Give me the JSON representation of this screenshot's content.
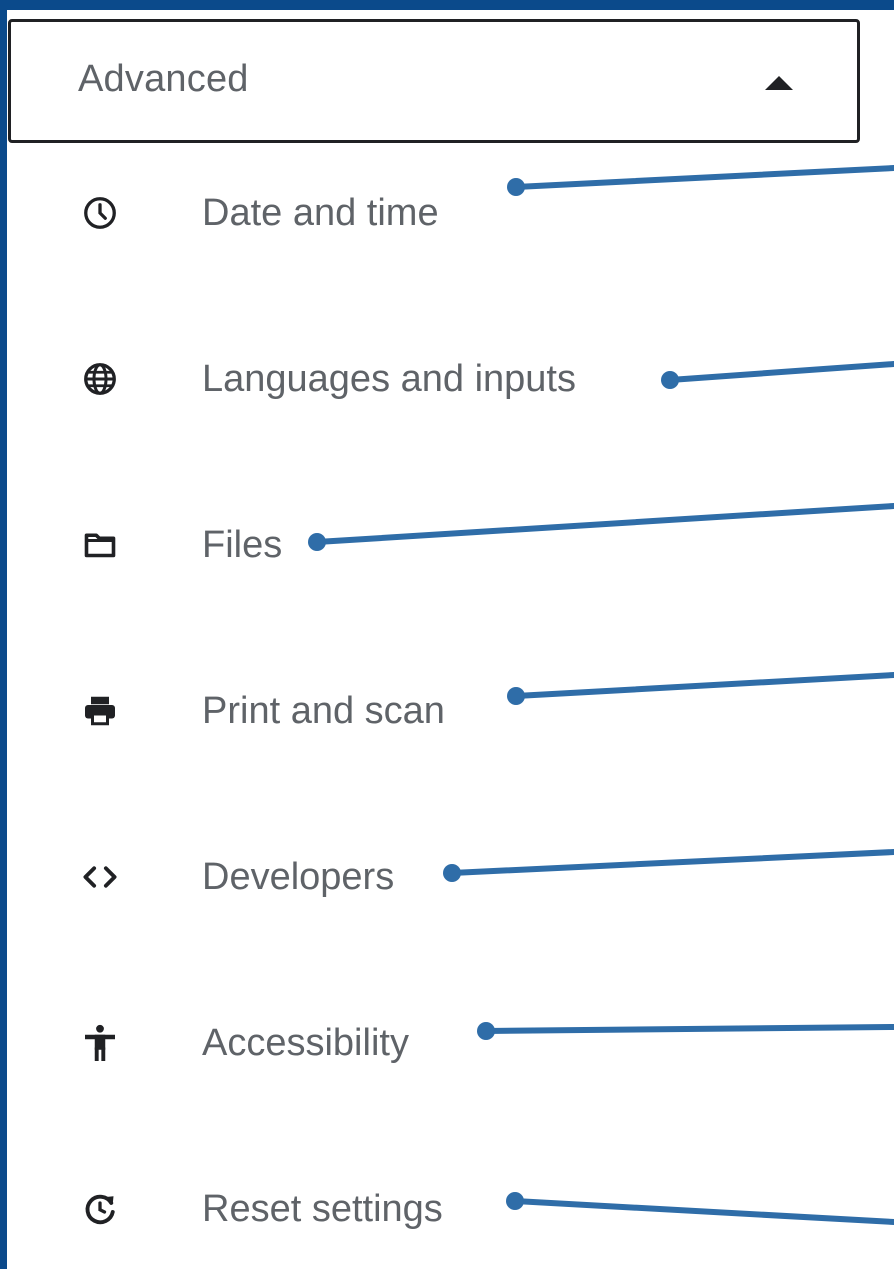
{
  "header": {
    "label": "Advanced",
    "caret_icon": "caret-up-icon"
  },
  "menu": {
    "items": [
      {
        "label": "Date and time",
        "icon": "clock-icon"
      },
      {
        "label": "Languages and inputs",
        "icon": "globe-icon"
      },
      {
        "label": "Files",
        "icon": "folder-icon"
      },
      {
        "label": "Print and scan",
        "icon": "printer-icon"
      },
      {
        "label": "Developers",
        "icon": "code-brackets-icon"
      },
      {
        "label": "Accessibility",
        "icon": "accessibility-icon"
      },
      {
        "label": "Reset settings",
        "icon": "reset-icon"
      }
    ]
  },
  "colors": {
    "frame": "#0b4a8b",
    "callout": "#2f6da8",
    "text": "#5f6368",
    "icon": "#202124"
  }
}
